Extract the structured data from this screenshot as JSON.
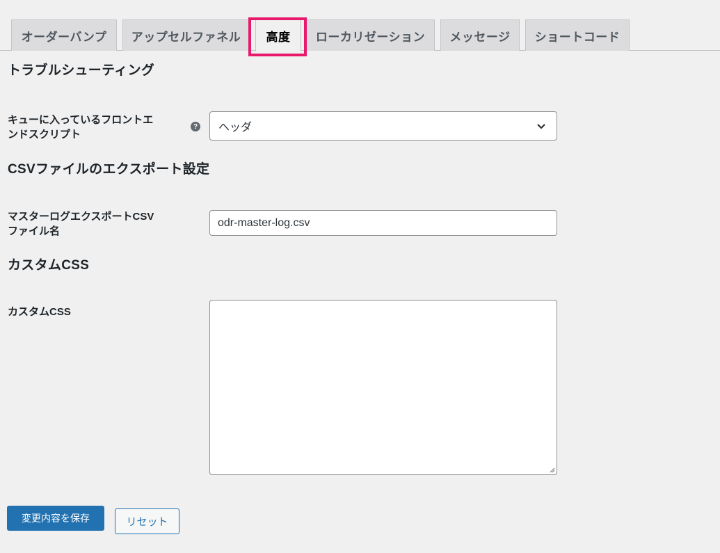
{
  "tabs": [
    {
      "label": "オーダーバンプ",
      "active": false
    },
    {
      "label": "アップセルファネル",
      "active": false
    },
    {
      "label": "高度",
      "active": true
    },
    {
      "label": "ローカリゼーション",
      "active": false
    },
    {
      "label": "メッセージ",
      "active": false
    },
    {
      "label": "ショートコード",
      "active": false
    }
  ],
  "sections": {
    "troubleshooting": {
      "title": "トラブルシューティング",
      "field_label_line1": "キューに入っているフロントエ",
      "field_label_line2": "ンドスクリプト",
      "help_icon": "question-circle-icon",
      "select_value": "ヘッダ"
    },
    "csv_export": {
      "title": "CSVファイルのエクスポート設定",
      "field_label_line1": "マスターログエクスポートCSV",
      "field_label_line2": "ファイル名",
      "input_value": "odr-master-log.csv"
    },
    "custom_css": {
      "title": "カスタムCSS",
      "field_label": "カスタムCSS",
      "textarea_value": ""
    }
  },
  "actions": {
    "save_label": "変更内容を保存",
    "reset_label": "リセット"
  },
  "colors": {
    "highlight": "#e8196b",
    "primary": "#2271b1",
    "background": "#f0f0f1"
  }
}
